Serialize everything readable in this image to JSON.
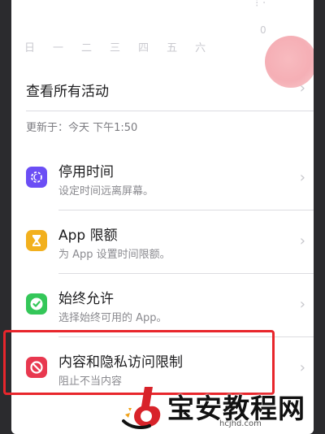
{
  "weekdays": [
    "日",
    "一",
    "二",
    "三",
    "四",
    "五",
    "六"
  ],
  "chart_axis_top": "0",
  "see_all_activity": "查看所有活动",
  "updated_text": "更新于：今天 下午1:50",
  "rows": [
    {
      "title": "停用时间",
      "subtitle": "设定时间远离屏幕。",
      "icon": "downtime-icon",
      "color": "#6b4ef5"
    },
    {
      "title": "App 限额",
      "subtitle": "为 App 设置时间限额。",
      "icon": "hourglass-icon",
      "color": "#f2b01e"
    },
    {
      "title": "始终允许",
      "subtitle": "选择始终可用的 App。",
      "icon": "checkmark-icon",
      "color": "#34c759"
    },
    {
      "title": "内容和隐私访问限制",
      "subtitle": "阻止不当内容",
      "icon": "restriction-icon",
      "color": "#e8384f"
    }
  ],
  "watermark": {
    "name": "宝安教程网",
    "url": "hcjhd.com"
  },
  "colors": {
    "highlight": "#e8262c",
    "background": "#f2f1f6"
  }
}
